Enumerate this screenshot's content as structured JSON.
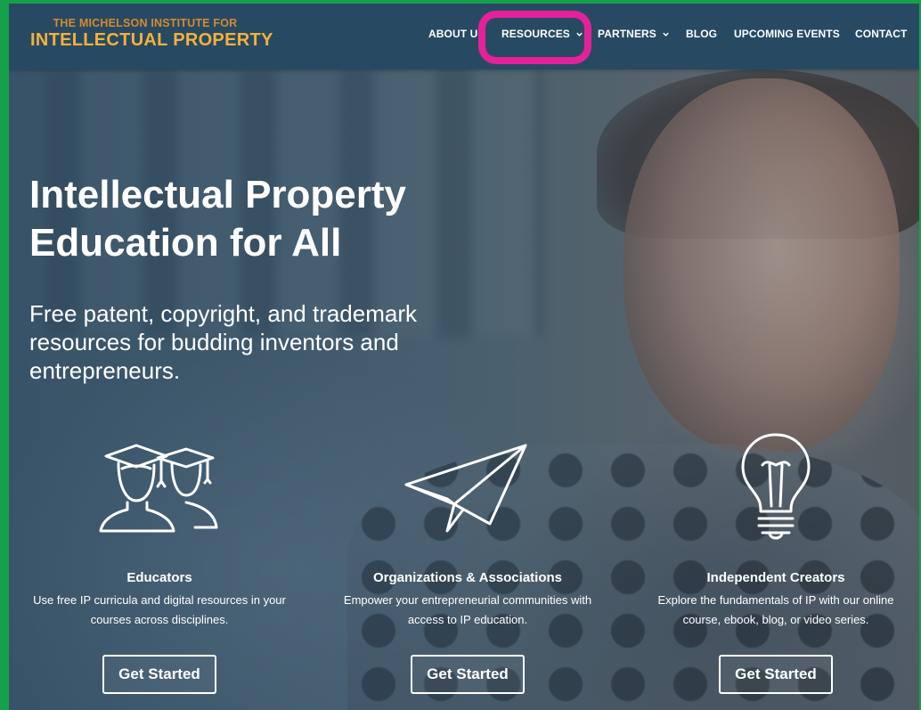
{
  "logo": {
    "line1": "THE MICHELSON INSTITUTE FOR",
    "line2": "INTELLECTUAL PROPERTY"
  },
  "nav": {
    "items": [
      {
        "label": "ABOUT US",
        "dropdown": false
      },
      {
        "label": "RESOURCES",
        "dropdown": true,
        "highlighted": true
      },
      {
        "label": "PARTNERS",
        "dropdown": true
      },
      {
        "label": "BLOG",
        "dropdown": false
      },
      {
        "label": "UPCOMING EVENTS",
        "dropdown": false
      },
      {
        "label": "CONTACT",
        "dropdown": false
      }
    ]
  },
  "hero": {
    "headline": "Intellectual Property Education for All",
    "subhead": "Free patent, copyright, and trademark resources for budding inventors and entrepreneurs."
  },
  "columns": [
    {
      "icon": "graduates-icon",
      "title": "Educators",
      "description": "Use free IP curricula and digital resources in your courses across disciplines.",
      "button": "Get Started"
    },
    {
      "icon": "paper-plane-icon",
      "title": "Organizations & Associations",
      "description": "Empower your entrepreneurial communities with access to IP education.",
      "button": "Get Started"
    },
    {
      "icon": "lightbulb-icon",
      "title": "Independent Creators",
      "description": "Explore the fundamentals of IP with our online course, ebook, blog, or video series.",
      "button": "Get Started"
    }
  ],
  "colors": {
    "header_bg": "#274a62",
    "logo_accent": "#f3b13d",
    "highlight_ring": "#e5219a",
    "frame_border": "#17a04a"
  }
}
